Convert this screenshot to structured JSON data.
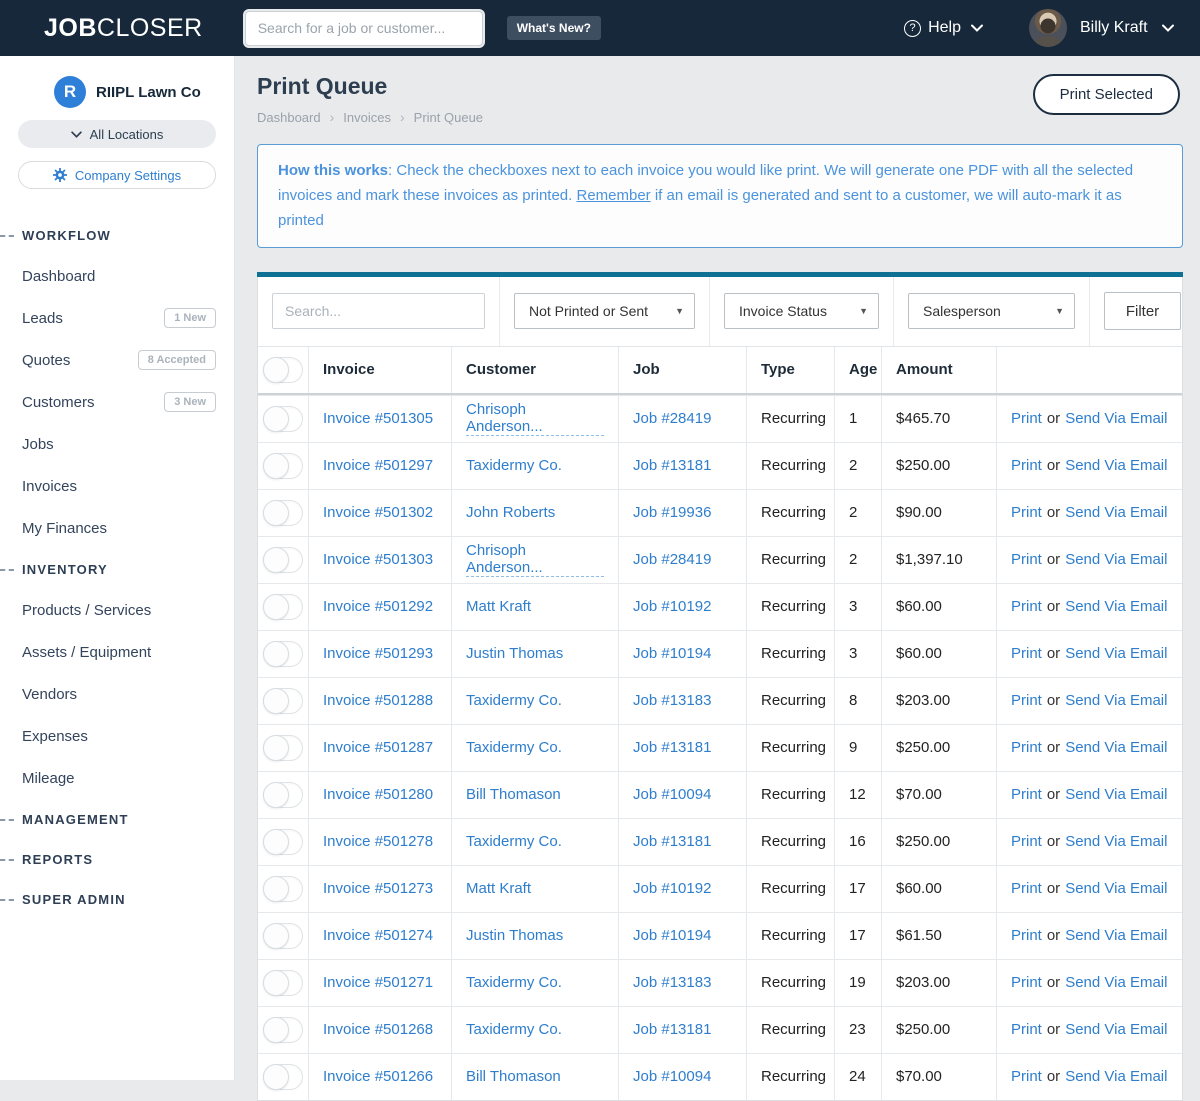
{
  "colors": {
    "header_navy": "#16283a",
    "accent_teal": "#0e7193",
    "link_blue": "#2e7ecd",
    "info_blue": "#4b93dd",
    "brand_blue": "#2e7fd8"
  },
  "header": {
    "logo_bold": "JOB",
    "logo_light": "CLOSER",
    "search_placeholder": "Search for a job or customer...",
    "whats_new_label": "What's New?",
    "help_label": "Help",
    "user_name": "Billy Kraft"
  },
  "sidebar": {
    "company_initial": "R",
    "company_name": "RIIPL Lawn Co",
    "locations_label": "All Locations",
    "settings_label": "Company Settings",
    "sections": [
      {
        "label": "WORKFLOW",
        "items": [
          {
            "label": "Dashboard"
          },
          {
            "label": "Leads",
            "badge": "1 New"
          },
          {
            "label": "Quotes",
            "badge": "8 Accepted"
          },
          {
            "label": "Customers",
            "badge": "3 New"
          },
          {
            "label": "Jobs"
          },
          {
            "label": "Invoices"
          },
          {
            "label": "My Finances"
          }
        ]
      },
      {
        "label": "INVENTORY",
        "items": [
          {
            "label": "Products / Services"
          },
          {
            "label": "Assets / Equipment"
          },
          {
            "label": "Vendors"
          },
          {
            "label": "Expenses"
          },
          {
            "label": "Mileage"
          }
        ]
      },
      {
        "label": "MANAGEMENT",
        "items": []
      },
      {
        "label": "REPORTS",
        "items": []
      },
      {
        "label": "SUPER ADMIN",
        "items": []
      }
    ]
  },
  "page": {
    "title": "Print Queue",
    "breadcrumb": [
      "Dashboard",
      "Invoices",
      "Print Queue"
    ],
    "print_selected_label": "Print Selected",
    "info": {
      "lead": "How this works",
      "text1": ": Check the checkboxes next to each invoice you would like print. We will generate one PDF with all the selected invoices and mark these invoices as printed. ",
      "underlined": "Remember",
      "text2": " if an email is generated and sent to a customer, we will auto-mark it as printed"
    }
  },
  "filters": {
    "search_placeholder": "Search...",
    "selects": [
      "Not Printed or Sent",
      "Invoice Status",
      "Salesperson"
    ],
    "filter_label": "Filter"
  },
  "table": {
    "headers": [
      "Invoice",
      "Customer",
      "Job",
      "Type",
      "Age",
      "Amount"
    ],
    "action": {
      "print": "Print",
      "or": "or",
      "email": "Send Via Email"
    },
    "rows": [
      {
        "invoice": "Invoice #501305",
        "customer": "Chrisoph Anderson...",
        "job": "Job #28419",
        "type": "Recurring",
        "age": "1",
        "amount": "$465.70"
      },
      {
        "invoice": "Invoice #501297",
        "customer": "Taxidermy Co.",
        "job": "Job #13181",
        "type": "Recurring",
        "age": "2",
        "amount": "$250.00"
      },
      {
        "invoice": "Invoice #501302",
        "customer": "John Roberts",
        "job": "Job #19936",
        "type": "Recurring",
        "age": "2",
        "amount": "$90.00"
      },
      {
        "invoice": "Invoice #501303",
        "customer": "Chrisoph Anderson...",
        "job": "Job #28419",
        "type": "Recurring",
        "age": "2",
        "amount": "$1,397.10"
      },
      {
        "invoice": "Invoice #501292",
        "customer": "Matt Kraft",
        "job": "Job #10192",
        "type": "Recurring",
        "age": "3",
        "amount": "$60.00"
      },
      {
        "invoice": "Invoice #501293",
        "customer": "Justin Thomas",
        "job": "Job #10194",
        "type": "Recurring",
        "age": "3",
        "amount": "$60.00"
      },
      {
        "invoice": "Invoice #501288",
        "customer": "Taxidermy Co.",
        "job": "Job #13183",
        "type": "Recurring",
        "age": "8",
        "amount": "$203.00"
      },
      {
        "invoice": "Invoice #501287",
        "customer": "Taxidermy Co.",
        "job": "Job #13181",
        "type": "Recurring",
        "age": "9",
        "amount": "$250.00"
      },
      {
        "invoice": "Invoice #501280",
        "customer": "Bill Thomason",
        "job": "Job #10094",
        "type": "Recurring",
        "age": "12",
        "amount": "$70.00"
      },
      {
        "invoice": "Invoice #501278",
        "customer": "Taxidermy Co.",
        "job": "Job #13181",
        "type": "Recurring",
        "age": "16",
        "amount": "$250.00"
      },
      {
        "invoice": "Invoice #501273",
        "customer": "Matt Kraft",
        "job": "Job #10192",
        "type": "Recurring",
        "age": "17",
        "amount": "$60.00"
      },
      {
        "invoice": "Invoice #501274",
        "customer": "Justin Thomas",
        "job": "Job #10194",
        "type": "Recurring",
        "age": "17",
        "amount": "$61.50"
      },
      {
        "invoice": "Invoice #501271",
        "customer": "Taxidermy Co.",
        "job": "Job #13183",
        "type": "Recurring",
        "age": "19",
        "amount": "$203.00"
      },
      {
        "invoice": "Invoice #501268",
        "customer": "Taxidermy Co.",
        "job": "Job #13181",
        "type": "Recurring",
        "age": "23",
        "amount": "$250.00"
      },
      {
        "invoice": "Invoice #501266",
        "customer": "Bill Thomason",
        "job": "Job #10094",
        "type": "Recurring",
        "age": "24",
        "amount": "$70.00"
      }
    ]
  }
}
